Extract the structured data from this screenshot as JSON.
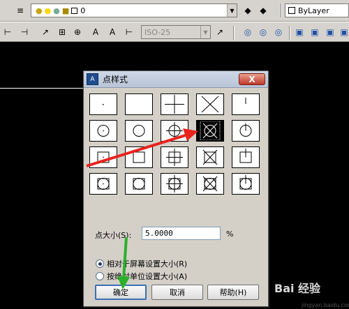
{
  "toolbar_top": {
    "layer_combo_value": "0",
    "bylayer_combo_value": "ByLayer"
  },
  "toolbar_bottom": {
    "dimstyle_combo_value": "ISO-25"
  },
  "dialog": {
    "title": "点样式",
    "close_label": "X",
    "point_size_label": "点大小(S):",
    "point_size_value": "5.0000",
    "percent_suffix": "%",
    "radio_relative": "相对于屏幕设置大小(R)",
    "radio_absolute": "按绝对单位设置大小(A)",
    "radio_selected": "relative",
    "ok_label": "确定",
    "cancel_label": "取消",
    "help_label": "帮助(H)",
    "selected_style_index": 8
  },
  "watermark": {
    "brand": "Bai 经验",
    "site": "jingyan.baidu.com"
  },
  "colors": {
    "annotation_arrow_red": "#e8231e",
    "annotation_arrow_green": "#2bb02a"
  }
}
